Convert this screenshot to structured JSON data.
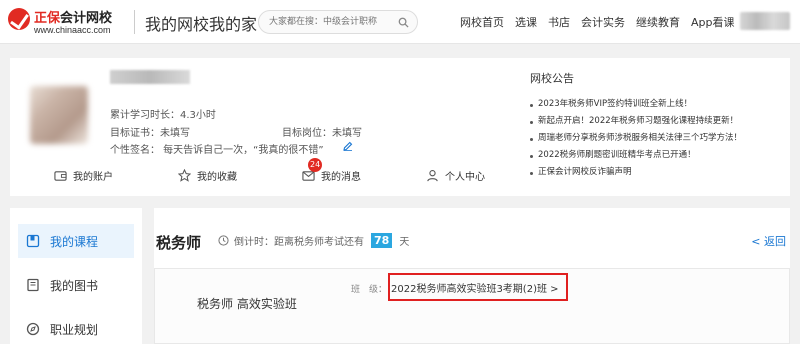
{
  "header": {
    "logo_brand": "正保",
    "logo_sub": "会计网校",
    "logo_url": "www.chinaacc.com",
    "site_title": "我的网校我的家",
    "search_placeholder": "大家都在搜：中级会计职称",
    "nav": [
      "网校首页",
      "选课",
      "书店",
      "会计实务",
      "继续教育",
      "App看课"
    ]
  },
  "profile": {
    "study_time": "累计学习时长：4.3小时",
    "target_cert": "目标证书：未填写",
    "target_job": "目标岗位：未填写",
    "signature": "个性签名： 每天告诉自己一次，“我真的很不错”",
    "actions": [
      {
        "label": "我的账户",
        "icon": "wallet-icon"
      },
      {
        "label": "我的收藏",
        "icon": "star-icon"
      },
      {
        "label": "我的消息",
        "icon": "mail-icon",
        "badge": "24"
      },
      {
        "label": "个人中心",
        "icon": "user-icon"
      }
    ]
  },
  "notice": {
    "title": "网校公告",
    "items": [
      "2023年税务师VIP签约特训班全新上线！",
      "新起点开启！2022年税务师习题强化课程持续更新！",
      "周瑞老师分享税务师涉税服务相关法律三个巧学方法！",
      "2022税务师刷题密训班精华考点已开通！",
      "正保会计网校反诈骗声明"
    ]
  },
  "sidebar": {
    "items": [
      {
        "label": "我的课程",
        "icon": "course-icon",
        "active": true
      },
      {
        "label": "我的图书",
        "icon": "book-icon",
        "active": false
      },
      {
        "label": "职业规划",
        "icon": "compass-icon",
        "active": false
      }
    ]
  },
  "main": {
    "course_title": "税务师",
    "countdown_prefix": "倒计时：距离税务师考试还有",
    "countdown_days": "78",
    "countdown_suffix": "天",
    "back_label": "< 返回",
    "class_name": "税务师 高效实验班",
    "class_label": "班　级：",
    "class_value": "2022税务师高效实验班3考期(2)班 >"
  },
  "colors": {
    "brand_red": "#e12b23",
    "link_blue": "#1a77d2",
    "days_badge": "#2ba7e0",
    "highlight_box": "#e02020"
  }
}
